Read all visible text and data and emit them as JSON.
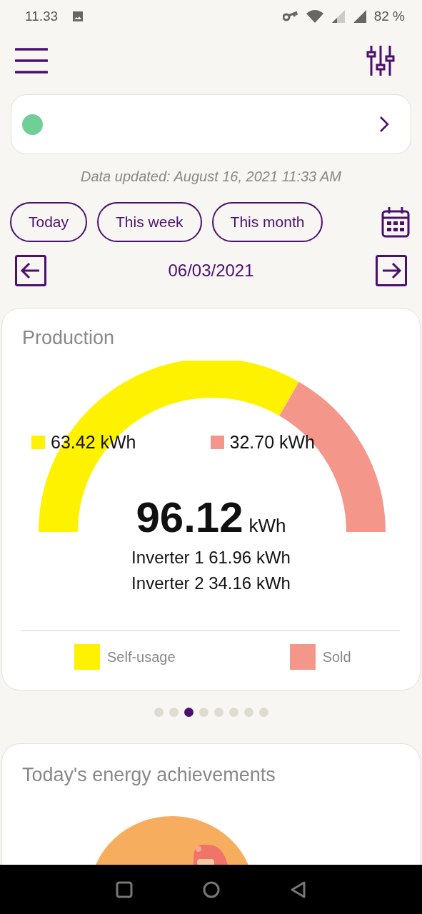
{
  "status_bar": {
    "time": "11.33",
    "battery": "82 %"
  },
  "status_card": {
    "color": "#6fcf97"
  },
  "updated": "Data updated: August 16, 2021 11:33 AM",
  "tabs": [
    {
      "label": "Today",
      "selected": false
    },
    {
      "label": "This week",
      "selected": false
    },
    {
      "label": "This month",
      "selected": false
    }
  ],
  "date": "06/03/2021",
  "production": {
    "title": "Production",
    "segments": [
      {
        "name": "Self-usage",
        "value": "63.42 kWh",
        "color": "#fff200"
      },
      {
        "name": "Sold",
        "value": "32.70 kWh",
        "color": "#f4968a"
      }
    ],
    "total": "96.12",
    "unit": "kWh",
    "inverters": [
      "Inverter 1 61.96 kWh",
      "Inverter 2 34.16 kWh"
    ]
  },
  "pages": [
    {
      "selected": false
    },
    {
      "selected": false
    },
    {
      "selected": true
    },
    {
      "selected": false
    },
    {
      "selected": false
    },
    {
      "selected": false
    },
    {
      "selected": false
    },
    {
      "selected": false
    }
  ],
  "achievements": {
    "title": "Today's energy achievements"
  }
}
